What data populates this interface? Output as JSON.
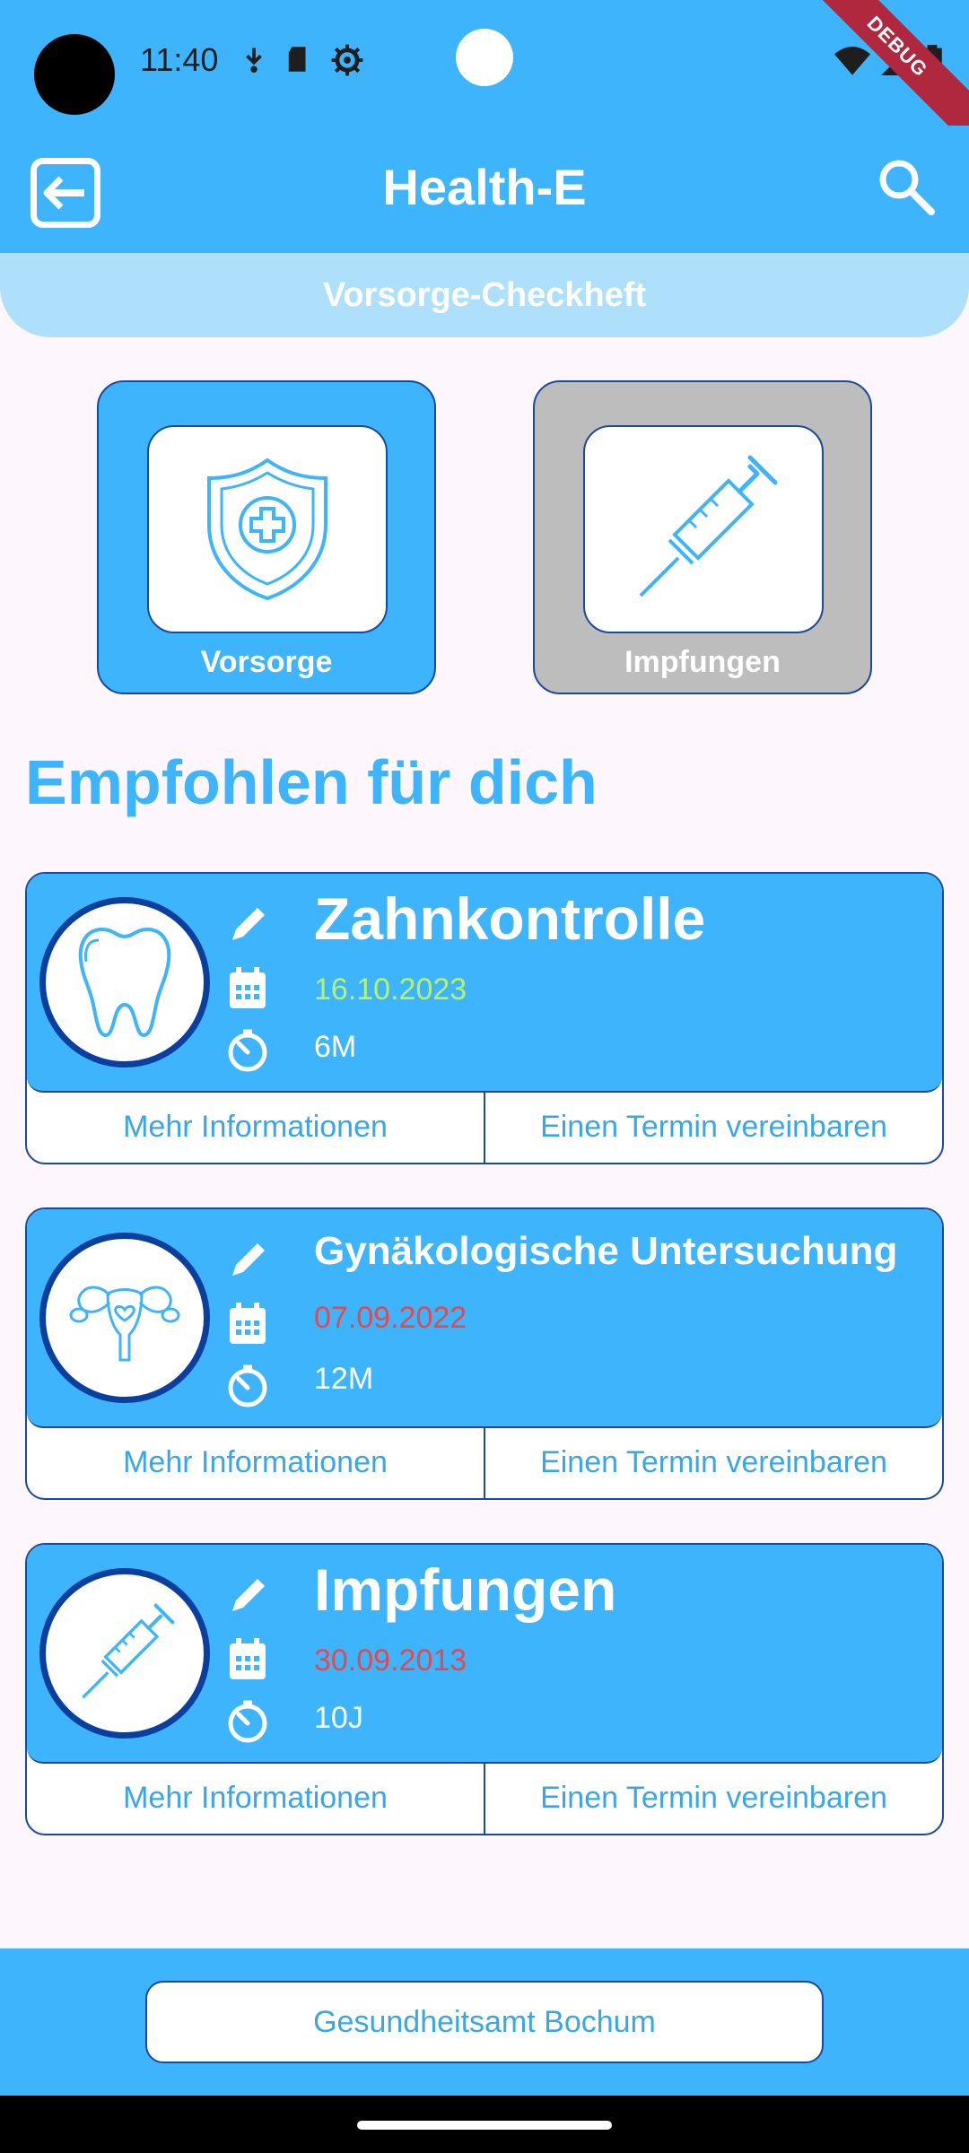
{
  "status_bar": {
    "time": "11:40",
    "debug_label": "DEBUG"
  },
  "app_bar": {
    "title": "Health-E"
  },
  "sub_bar": {
    "title": "Vorsorge-Checkheft"
  },
  "categories": [
    {
      "label": "Vorsorge",
      "icon": "shield-plus-icon"
    },
    {
      "label": "Impfungen",
      "icon": "syringe-icon"
    }
  ],
  "section": {
    "title": "Empfohlen für dich"
  },
  "recommendations": [
    {
      "title": "Zahnkontrolle",
      "date": "16.10.2023",
      "date_color": "#b7f26a",
      "interval": "6M",
      "icon": "tooth-icon",
      "more_label": "Mehr Informationen",
      "book_label": "Einen Termin vereinbaren"
    },
    {
      "title": "Gynäkologische Untersuchung",
      "date": "07.09.2022",
      "date_color": "#e5484d",
      "interval": "12M",
      "icon": "uterus-icon",
      "more_label": "Mehr Informationen",
      "book_label": "Einen Termin vereinbaren"
    },
    {
      "title": "Impfungen",
      "date": "30.09.2013",
      "date_color": "#e5484d",
      "interval": "10J",
      "icon": "syringe-icon",
      "more_label": "Mehr Informationen",
      "book_label": "Einen Termin vereinbaren"
    }
  ],
  "bottom_bar": {
    "button_label": "Gesundheitsamt Bochum"
  },
  "colors": {
    "primary": "#3db4fb",
    "accent_dark": "#1a4a9a",
    "date_ok": "#b7f26a",
    "date_overdue": "#e5484d"
  }
}
